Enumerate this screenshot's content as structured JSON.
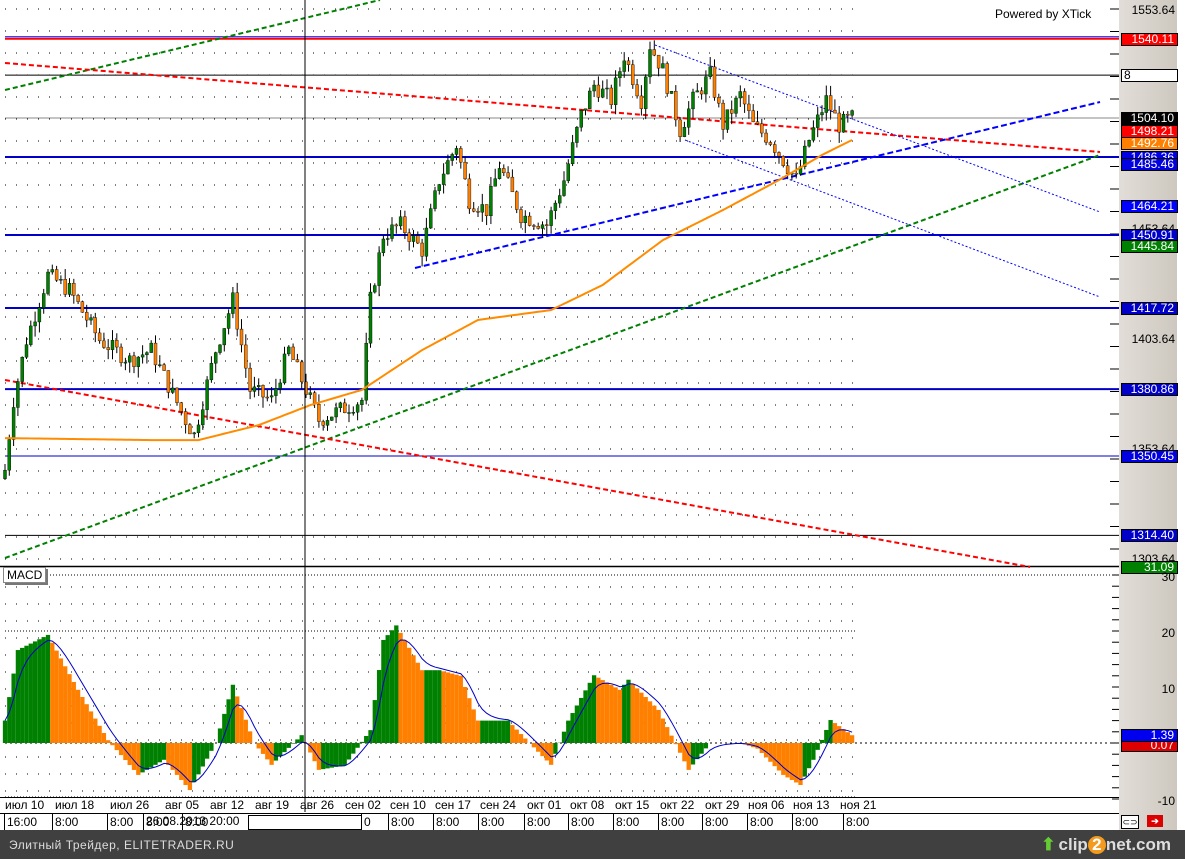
{
  "header": {
    "powered_by": "Powered by XTick"
  },
  "price_axis": {
    "ticks": [
      "1553.64",
      "1403.64",
      "1303.64"
    ],
    "hidden_ticks": [
      "1453.64",
      "1353.64"
    ],
    "markers": [
      {
        "text": "1540.11",
        "color": "#ff0000",
        "price": 1540.11
      },
      {
        "text": "8",
        "color": "#ffffff",
        "price": 1523.6
      },
      {
        "text": "1504.10",
        "color": "#000000",
        "price": 1504.1
      },
      {
        "text": "1498.21",
        "color": "#ff0000",
        "price": 1498.21
      },
      {
        "text": "1492.76",
        "color": "#ff8000",
        "price": 1492.76
      },
      {
        "text": "1486.36",
        "color": "#0000e0",
        "price": 1486.36
      },
      {
        "text": "1485.46",
        "color": "#0000e0",
        "price": 1483.2
      },
      {
        "text": "1464.21",
        "color": "#0000ff",
        "price": 1464.21
      },
      {
        "text": "1450.91",
        "color": "#0000c8",
        "price": 1450.91
      },
      {
        "text": "1445.84",
        "color": "#008000",
        "price": 1445.84
      },
      {
        "text": "1417.72",
        "color": "#0000c8",
        "price": 1417.72
      },
      {
        "text": "1380.86",
        "color": "#0000c8",
        "price": 1380.86
      },
      {
        "text": "1350.45",
        "color": "#0000e0",
        "price": 1350.45
      },
      {
        "text": "1314.40",
        "color": "#0000c8",
        "price": 1314.4
      }
    ]
  },
  "macd_axis": {
    "ticks": [
      "30",
      "20",
      "10",
      "-10"
    ],
    "value": "1.39",
    "signal": "0.07",
    "top_marker": "31.09"
  },
  "macd": {
    "label": "MACD"
  },
  "x_axis": {
    "dates": [
      "июл 10",
      "июл 18",
      "июл 26",
      "авг 05",
      "авг 12",
      "авг 19",
      "авг 26",
      "сен 02",
      "сен 10",
      "сен 17",
      "сен 24",
      "окт 01",
      "окт 08",
      "окт 15",
      "окт 22",
      "окт 29",
      "ноя 06",
      "ноя 13",
      "ноя 21"
    ],
    "times": [
      "16:00",
      "8:00",
      "8:00",
      "8:00",
      "8:00",
      "0",
      "8:00",
      "8:00",
      "8:00",
      "8:00",
      "8:00",
      "8:00",
      "8:00",
      "8:00",
      "8:00",
      "8:00",
      "8:00"
    ],
    "cursor_date": "26.08.2013 20:00"
  },
  "footer": {
    "left": "Элитный Трейдер, ELITETRADER.RU",
    "brand_a": "clip",
    "brand_b": "2",
    "brand_c": "net.com"
  },
  "colors": {
    "up": "#008000",
    "down": "#ff8000",
    "ma": "#ff8c00",
    "level": "#0000c8"
  },
  "chart_data": {
    "type": "candlestick",
    "price_range": [
      1303.64,
      1553.64
    ],
    "macd_range": [
      -10,
      30
    ],
    "close_waypoints": [
      [
        0,
        1344.1
      ],
      [
        2,
        1375.9
      ],
      [
        5,
        1403.2
      ],
      [
        10,
        1432.7
      ],
      [
        15,
        1425.9
      ],
      [
        22,
        1403.2
      ],
      [
        29,
        1394.1
      ],
      [
        34,
        1398.6
      ],
      [
        42,
        1366.8
      ],
      [
        44,
        1360
      ],
      [
        49,
        1398.6
      ],
      [
        53,
        1421.4
      ],
      [
        57,
        1380.5
      ],
      [
        62,
        1375.9
      ],
      [
        66,
        1398.6
      ],
      [
        70,
        1380.5
      ],
      [
        73,
        1366.8
      ],
      [
        78,
        1371.4
      ],
      [
        83,
        1375.9
      ],
      [
        85,
        1421.4
      ],
      [
        88,
        1450.9
      ],
      [
        92,
        1455.5
      ],
      [
        97,
        1444.1
      ],
      [
        101,
        1475.9
      ],
      [
        105,
        1491.8
      ],
      [
        108,
        1466.8
      ],
      [
        112,
        1462.3
      ],
      [
        115,
        1482.7
      ],
      [
        120,
        1460
      ],
      [
        126,
        1455.5
      ],
      [
        130,
        1475.9
      ],
      [
        134,
        1505.5
      ],
      [
        137,
        1519.1
      ],
      [
        141,
        1512.3
      ],
      [
        144,
        1532.7
      ],
      [
        148,
        1512.3
      ],
      [
        150,
        1537.3
      ],
      [
        153,
        1525.9
      ],
      [
        157,
        1498.6
      ],
      [
        160,
        1512.3
      ],
      [
        164,
        1523.6
      ],
      [
        167,
        1500.9
      ],
      [
        171,
        1514.5
      ],
      [
        174,
        1500.9
      ],
      [
        178,
        1494.1
      ],
      [
        181,
        1485
      ],
      [
        184,
        1475.9
      ],
      [
        187,
        1494.1
      ],
      [
        191,
        1512.3
      ],
      [
        194,
        1500.9
      ],
      [
        197,
        1504.1
      ]
    ],
    "ma_waypoints": [
      [
        0,
        1358.6
      ],
      [
        34,
        1357.7
      ],
      [
        45,
        1357.7
      ],
      [
        59,
        1364.5
      ],
      [
        71,
        1373.6
      ],
      [
        83,
        1380.5
      ],
      [
        97,
        1398.6
      ],
      [
        110,
        1412.3
      ],
      [
        127,
        1416.8
      ],
      [
        139,
        1428.2
      ],
      [
        153,
        1448.6
      ],
      [
        167,
        1462.3
      ],
      [
        180,
        1475.9
      ],
      [
        190,
        1487.3
      ],
      [
        197,
        1494.1
      ]
    ],
    "macd_waypoints": [
      [
        0,
        4
      ],
      [
        3,
        16.6
      ],
      [
        10,
        19.3
      ],
      [
        17,
        9.5
      ],
      [
        24,
        0.5
      ],
      [
        31,
        -5.7
      ],
      [
        37,
        -3
      ],
      [
        43,
        -8.4
      ],
      [
        49,
        0
      ],
      [
        53,
        10.4
      ],
      [
        58,
        0
      ],
      [
        62,
        -3.9
      ],
      [
        69,
        1.4
      ],
      [
        73,
        -4.8
      ],
      [
        79,
        -4
      ],
      [
        85,
        2.3
      ],
      [
        88,
        18.4
      ],
      [
        91,
        21
      ],
      [
        97,
        13
      ],
      [
        101,
        13
      ],
      [
        106,
        12
      ],
      [
        110,
        4
      ],
      [
        117,
        4
      ],
      [
        122,
        0
      ],
      [
        127,
        -3.9
      ],
      [
        131,
        4
      ],
      [
        137,
        12.1
      ],
      [
        143,
        9.5
      ],
      [
        145,
        11.3
      ],
      [
        152,
        5.9
      ],
      [
        159,
        -4.8
      ],
      [
        164,
        0
      ],
      [
        171,
        0
      ],
      [
        175,
        -1
      ],
      [
        181,
        -5.7
      ],
      [
        185,
        -7.5
      ],
      [
        188,
        -3
      ],
      [
        192,
        4.1
      ],
      [
        197,
        1.39
      ]
    ],
    "levels": [
      1540.11,
      1486.36,
      1450.91,
      1417.72,
      1380.86,
      1350.45
    ]
  }
}
